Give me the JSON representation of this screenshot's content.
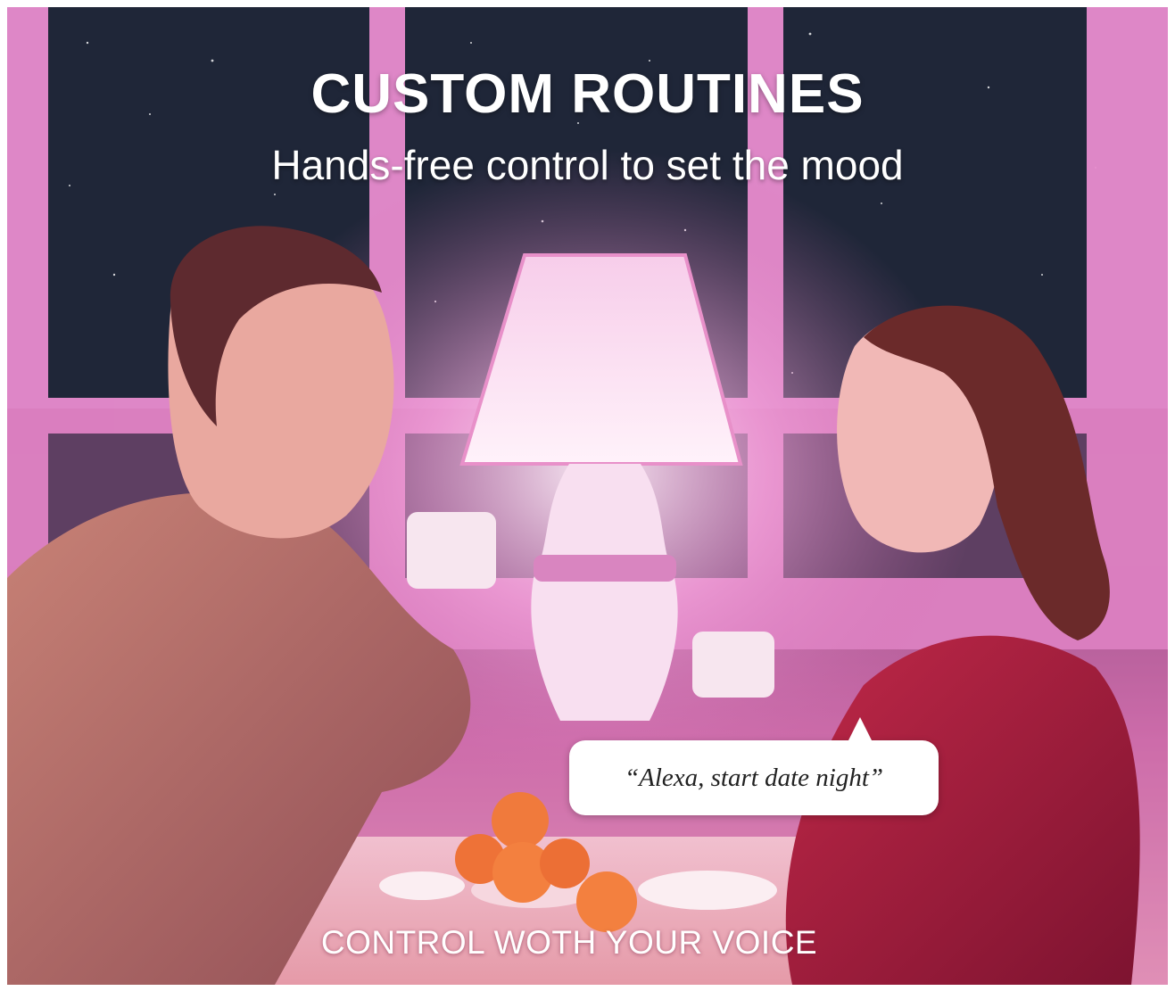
{
  "headline": "CUSTOM ROUTINES",
  "subheadline": "Hands-free control to set the mood",
  "speech_bubble": "“Alexa, start date night”",
  "caption": "CONTROL WOTH YOUR VOICE",
  "colors": {
    "night_sky": "#1f2638",
    "window_frame": "#e98ccf",
    "ambient_pink": "#d36fb3",
    "lamp_glow": "#fbe3f3",
    "man_sweater": "#b8706f",
    "woman_sweater": "#a81e3e",
    "text": "#ffffff"
  }
}
